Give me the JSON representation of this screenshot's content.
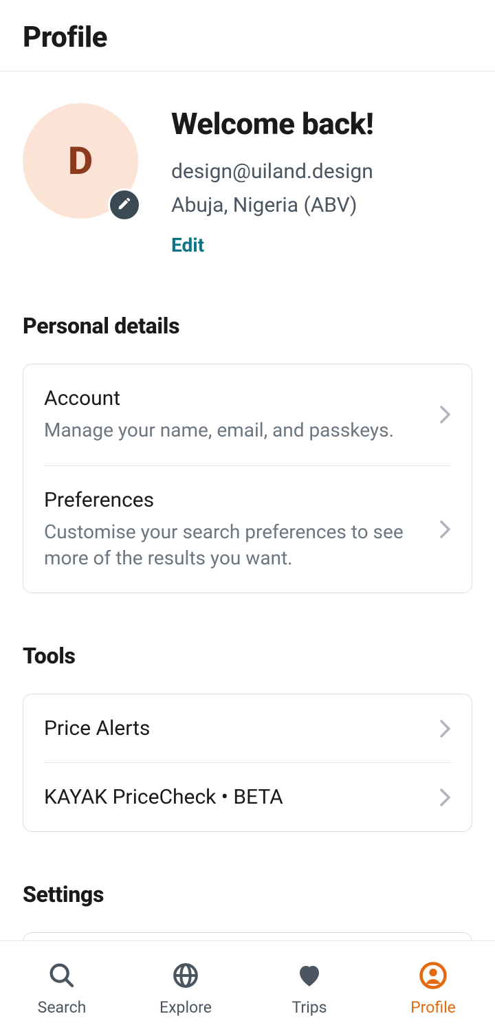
{
  "header": {
    "title": "Profile"
  },
  "profile": {
    "avatar_letter": "D",
    "welcome": "Welcome back!",
    "email": "design@uiland.design",
    "location": "Abuja, Nigeria (ABV)",
    "edit_label": "Edit"
  },
  "sections": {
    "personal": {
      "title": "Personal details",
      "items": [
        {
          "title": "Account",
          "subtitle": "Manage your name, email, and passkeys."
        },
        {
          "title": "Preferences",
          "subtitle": "Customise your search preferences to see more of the results you want."
        }
      ]
    },
    "tools": {
      "title": "Tools",
      "items": [
        {
          "title": "Price Alerts"
        },
        {
          "title": "KAYAK PriceCheck • BETA"
        }
      ]
    },
    "settings": {
      "title": "Settings"
    }
  },
  "nav": {
    "items": [
      {
        "label": "Search"
      },
      {
        "label": "Explore"
      },
      {
        "label": "Trips"
      },
      {
        "label": "Profile"
      }
    ],
    "active_index": 3
  },
  "colors": {
    "accent": "#e56910",
    "teal": "#0d7488",
    "avatar_bg": "#fbe4d6",
    "avatar_fg": "#8b3a1e"
  }
}
